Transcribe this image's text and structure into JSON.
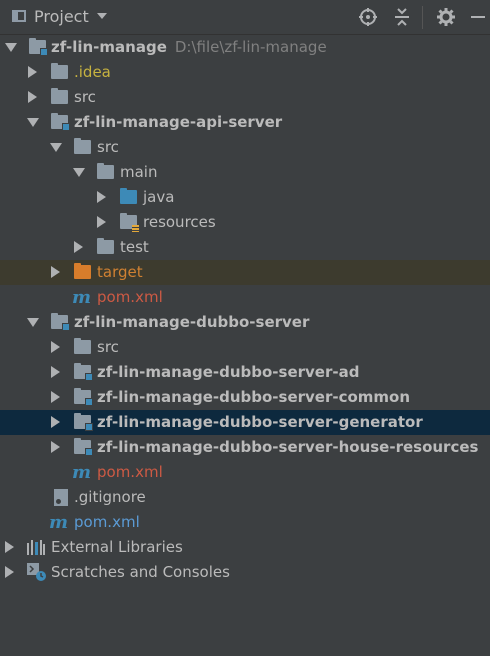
{
  "header": {
    "title": "Project"
  },
  "toolbar_icons": [
    "locate-icon",
    "collapse-all-icon",
    "settings-icon",
    "hide-icon"
  ],
  "tree": [
    {
      "label": "zf-lin-manage",
      "hint": "D:\\file\\zf-lin-manage",
      "icon": "module-folder"
    },
    {
      "label": ".idea",
      "icon": "folder"
    },
    {
      "label": "src",
      "icon": "folder"
    },
    {
      "label": "zf-lin-manage-api-server",
      "icon": "module-folder"
    },
    {
      "label": "src",
      "icon": "folder"
    },
    {
      "label": "main",
      "icon": "folder"
    },
    {
      "label": "java",
      "icon": "source-folder"
    },
    {
      "label": "resources",
      "icon": "resources-folder"
    },
    {
      "label": "test",
      "icon": "folder"
    },
    {
      "label": "target",
      "icon": "excluded-folder"
    },
    {
      "label": "pom.xml",
      "icon": "maven-file"
    },
    {
      "label": "zf-lin-manage-dubbo-server",
      "icon": "module-folder"
    },
    {
      "label": "src",
      "icon": "folder"
    },
    {
      "label": "zf-lin-manage-dubbo-server-ad",
      "icon": "module-folder"
    },
    {
      "label": "zf-lin-manage-dubbo-server-common",
      "icon": "module-folder"
    },
    {
      "label": "zf-lin-manage-dubbo-server-generator",
      "icon": "module-folder"
    },
    {
      "label": "zf-lin-manage-dubbo-server-house-resources",
      "icon": "module-folder"
    },
    {
      "label": "pom.xml",
      "icon": "maven-file"
    },
    {
      "label": ".gitignore",
      "icon": "git-file"
    },
    {
      "label": "pom.xml",
      "icon": "maven-file"
    },
    {
      "label": "External Libraries",
      "icon": "libraries-icon"
    },
    {
      "label": "Scratches and Consoles",
      "icon": "scratches-icon"
    }
  ],
  "colors": {
    "background": "#3c3f41",
    "selection": "#0d293e",
    "excluded_row": "#3d3b2e",
    "module_blue": "#3d8ab7",
    "excluded_orange": "#d87d2b",
    "pom_red": "#cc5a44",
    "idea_yellow": "#c6b240"
  }
}
